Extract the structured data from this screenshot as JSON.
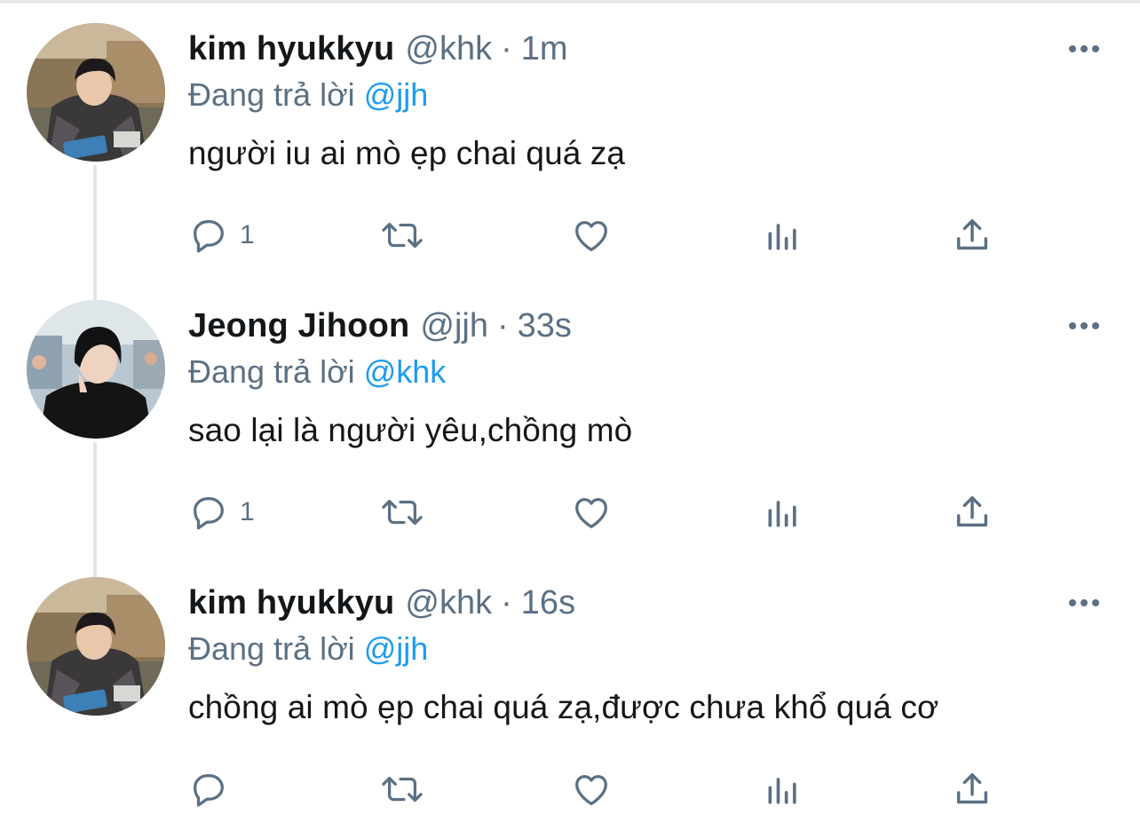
{
  "colors": {
    "accent": "#1d9bf0",
    "secondary_text": "#5b7083",
    "primary_text": "#14171a",
    "thread_line": "#e3e6e8"
  },
  "thread": [
    {
      "name": "kim hyukkyu",
      "handle": "@khk",
      "separator": "·",
      "time": "1m",
      "replying_prefix": "Đang trả lời",
      "replying_to": "@jjh",
      "text": "người iu ai mò ẹp chai quá zạ",
      "reply_count": "1",
      "avatar": "avatar-photo-khk"
    },
    {
      "name": "Jeong Jihoon",
      "handle": "@jjh",
      "separator": "·",
      "time": "33s",
      "replying_prefix": "Đang trả lời",
      "replying_to": "@khk",
      "text": "sao lại là người yêu,chồng mò",
      "reply_count": "1",
      "avatar": "avatar-photo-jjh"
    },
    {
      "name": "kim hyukkyu",
      "handle": "@khk",
      "separator": "·",
      "time": "16s",
      "replying_prefix": "Đang trả lời",
      "replying_to": "@jjh",
      "text": "chồng ai mò ẹp chai quá zạ,được chưa khổ quá cơ",
      "reply_count": "",
      "avatar": "avatar-photo-khk"
    }
  ],
  "icons": [
    "reply-icon",
    "retweet-icon",
    "like-icon",
    "analytics-icon",
    "share-icon",
    "more-icon"
  ]
}
